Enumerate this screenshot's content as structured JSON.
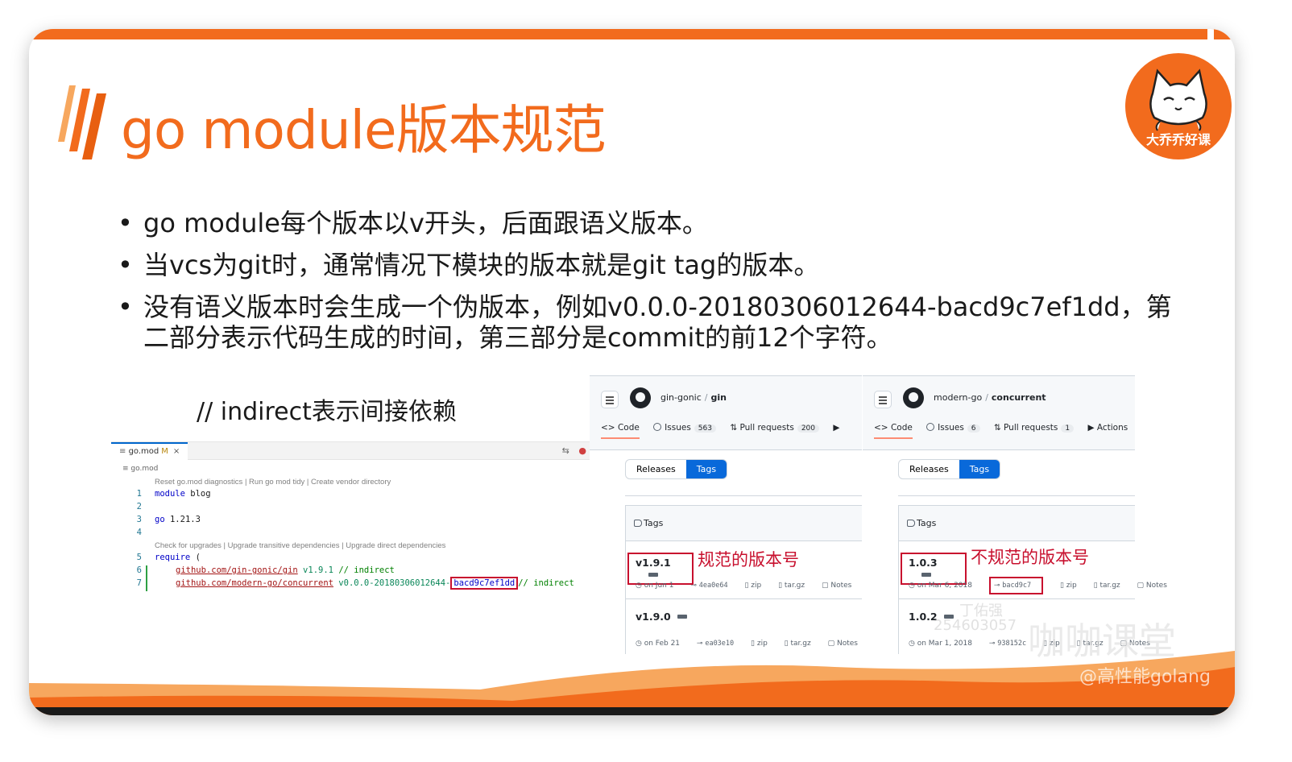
{
  "title": "go module版本规范",
  "logo_text": "大乔乔好课",
  "bullets": [
    "go module每个版本以v开头，后面跟语义版本。",
    "当vcs为git时，通常情况下模块的版本就是git tag的版本。",
    "没有语义版本时会生成一个伪版本，例如v0.0.0-20180306012644-bacd9c7ef1dd，第二部分表示代码生成的时间，第三部分是commit的前12个字符。"
  ],
  "indirect_note": "// indirect表示间接依赖",
  "editor": {
    "tab_label": "go.mod",
    "tab_modified": "M",
    "tab_close": "×",
    "breadcrumb": "≡ go.mod",
    "lens_1": "Reset go.mod diagnostics | Run go mod tidy | Create vendor directory",
    "lens_2": "Check for upgrades | Upgrade transitive dependencies | Upgrade direct dependencies",
    "lines": [
      {
        "num": "1",
        "kw": "module",
        "rest": " blog"
      },
      {
        "num": "2"
      },
      {
        "num": "3",
        "kw": "go",
        "rest": " 1.21.3"
      },
      {
        "num": "4"
      },
      {
        "num": "5",
        "kw": "require",
        "rest": " ("
      },
      {
        "num": "6",
        "path": "github.com/gin-gonic/gin",
        "version": "v1.9.1",
        "comment": "// indirect"
      },
      {
        "num": "7",
        "path": "github.com/modern-go/concurrent",
        "version": "v0.0.0-20180306012644-",
        "hash": "bacd9c7ef1dd",
        "comment": "// indirect"
      }
    ]
  },
  "gh_left": {
    "owner": "gin-gonic",
    "sep": "/",
    "repo": "gin",
    "nav": {
      "code": "Code",
      "issues": "Issues",
      "issues_count": "563",
      "prs": "Pull requests",
      "prs_count": "200"
    },
    "seg": {
      "releases": "Releases",
      "tags": "Tags"
    },
    "tags_header": "Tags",
    "annotation": "规范的版本号",
    "rows": [
      {
        "name": "v1.9.1",
        "date": "on Jun 1",
        "hash": "4ea0e64",
        "zip": "zip",
        "tar": "tar.gz",
        "notes": "Notes"
      },
      {
        "name": "v1.9.0",
        "date": "on Feb 21",
        "hash": "ea03e10",
        "zip": "zip",
        "tar": "tar.gz",
        "notes": "Notes"
      }
    ]
  },
  "gh_right": {
    "owner": "modern-go",
    "sep": "/",
    "repo": "concurrent",
    "nav": {
      "code": "Code",
      "issues": "Issues",
      "issues_count": "6",
      "prs": "Pull requests",
      "prs_count": "1",
      "actions": "Actions"
    },
    "seg": {
      "releases": "Releases",
      "tags": "Tags"
    },
    "tags_header": "Tags",
    "annotation": "不规范的版本号",
    "rows": [
      {
        "name": "1.0.3",
        "date": "on Mar 6, 2018",
        "hash": "bacd9c7",
        "zip": "zip",
        "tar": "tar.gz",
        "notes": "Notes"
      },
      {
        "name": "1.0.2",
        "date": "on Mar 1, 2018",
        "hash": "938152c",
        "zip": "zip",
        "tar": "tar.gz",
        "notes": "Notes"
      }
    ]
  },
  "watermark": {
    "name": "丁佑强",
    "id": "254603057",
    "brand": "咖咖课堂",
    "handle": "@高性能golang"
  },
  "colors": {
    "accent": "#f26b1d",
    "annotation": "#c8102e",
    "github_blue": "#0969da"
  }
}
